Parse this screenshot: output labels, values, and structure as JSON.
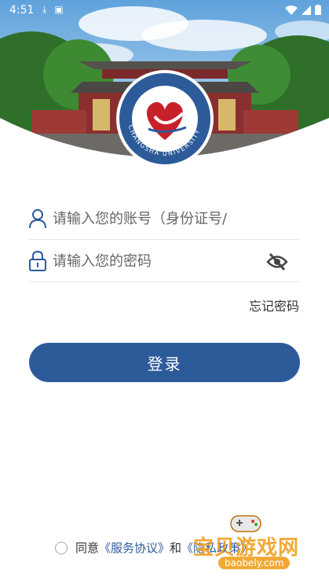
{
  "status_bar": {
    "time": "4:51"
  },
  "logo": {
    "ring_text": "CHANGSHA UNIVERSITY"
  },
  "form": {
    "account_placeholder": "请输入您的账号（身份证号/",
    "password_placeholder": "请输入您的密码",
    "forgot_label": "忘记密码",
    "login_label": "登录"
  },
  "agreement": {
    "prefix": "同意",
    "service_link": "《服务协议》",
    "and": "和",
    "privacy_link": "《隐私政策》"
  },
  "watermark": {
    "title": "宝贝游戏网",
    "url": "baobely.com"
  },
  "colors": {
    "primary": "#2d5b9a",
    "logo_red": "#c8202a",
    "sky": "#7fb6e6"
  }
}
